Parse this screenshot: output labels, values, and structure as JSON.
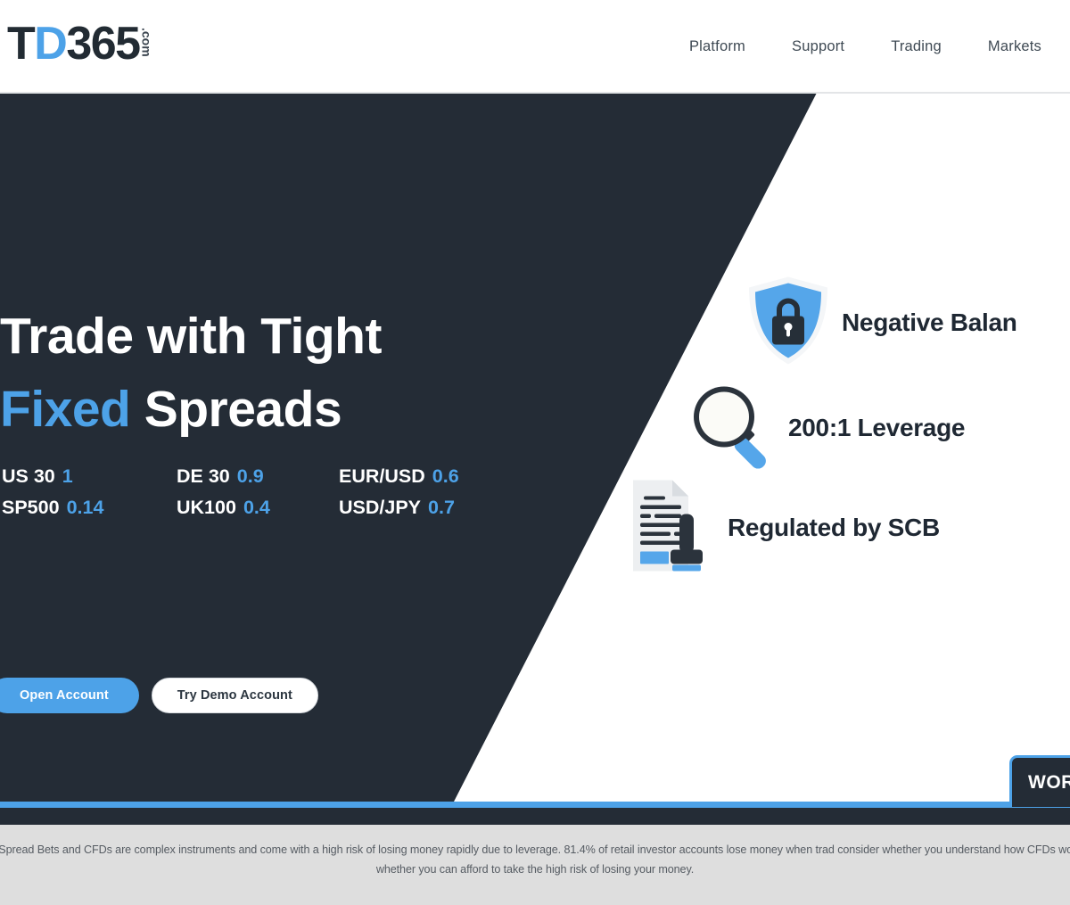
{
  "brand": {
    "logo_t": "T",
    "logo_d": "D",
    "logo_num": "365",
    "logo_tld": ".com",
    "accent_color": "#4da2e8",
    "dark_color": "#242c36"
  },
  "header": {
    "nav": [
      {
        "label": "Platform"
      },
      {
        "label": "Support"
      },
      {
        "label": "Trading"
      },
      {
        "label": "Markets"
      }
    ]
  },
  "hero": {
    "headline_line1": "Trade with Tight",
    "headline_line2_blue": "Fixed",
    "headline_line2_white": " Spreads",
    "spreads": [
      {
        "name": "US 30",
        "value": "1"
      },
      {
        "name": "DE 30",
        "value": "0.9"
      },
      {
        "name": "EUR/USD",
        "value": "0.6"
      },
      {
        "name": "SP500",
        "value": "0.14"
      },
      {
        "name": "UK100",
        "value": "0.4"
      },
      {
        "name": "USD/JPY",
        "value": "0.7"
      }
    ],
    "buttons": {
      "primary": "Open Account",
      "secondary": "Try Demo Account"
    },
    "features": [
      {
        "icon": "shield-lock-icon",
        "label": "Negative Balan"
      },
      {
        "icon": "magnifying-glass-icon",
        "label": "200:1 Leverage"
      },
      {
        "icon": "document-stamp-icon",
        "label": "Regulated by SCB"
      }
    ],
    "award_badge": "WOR"
  },
  "footer": {
    "disclaimer_line1": "ancial Spread Bets and CFDs are complex instruments and come with a high risk of losing money rapidly due to leverage. 81.4% of retail investor accounts lose money when trad",
    "disclaimer_line2": "consider whether you understand how CFDs work and whether you can afford to take the high risk of losing your money."
  }
}
